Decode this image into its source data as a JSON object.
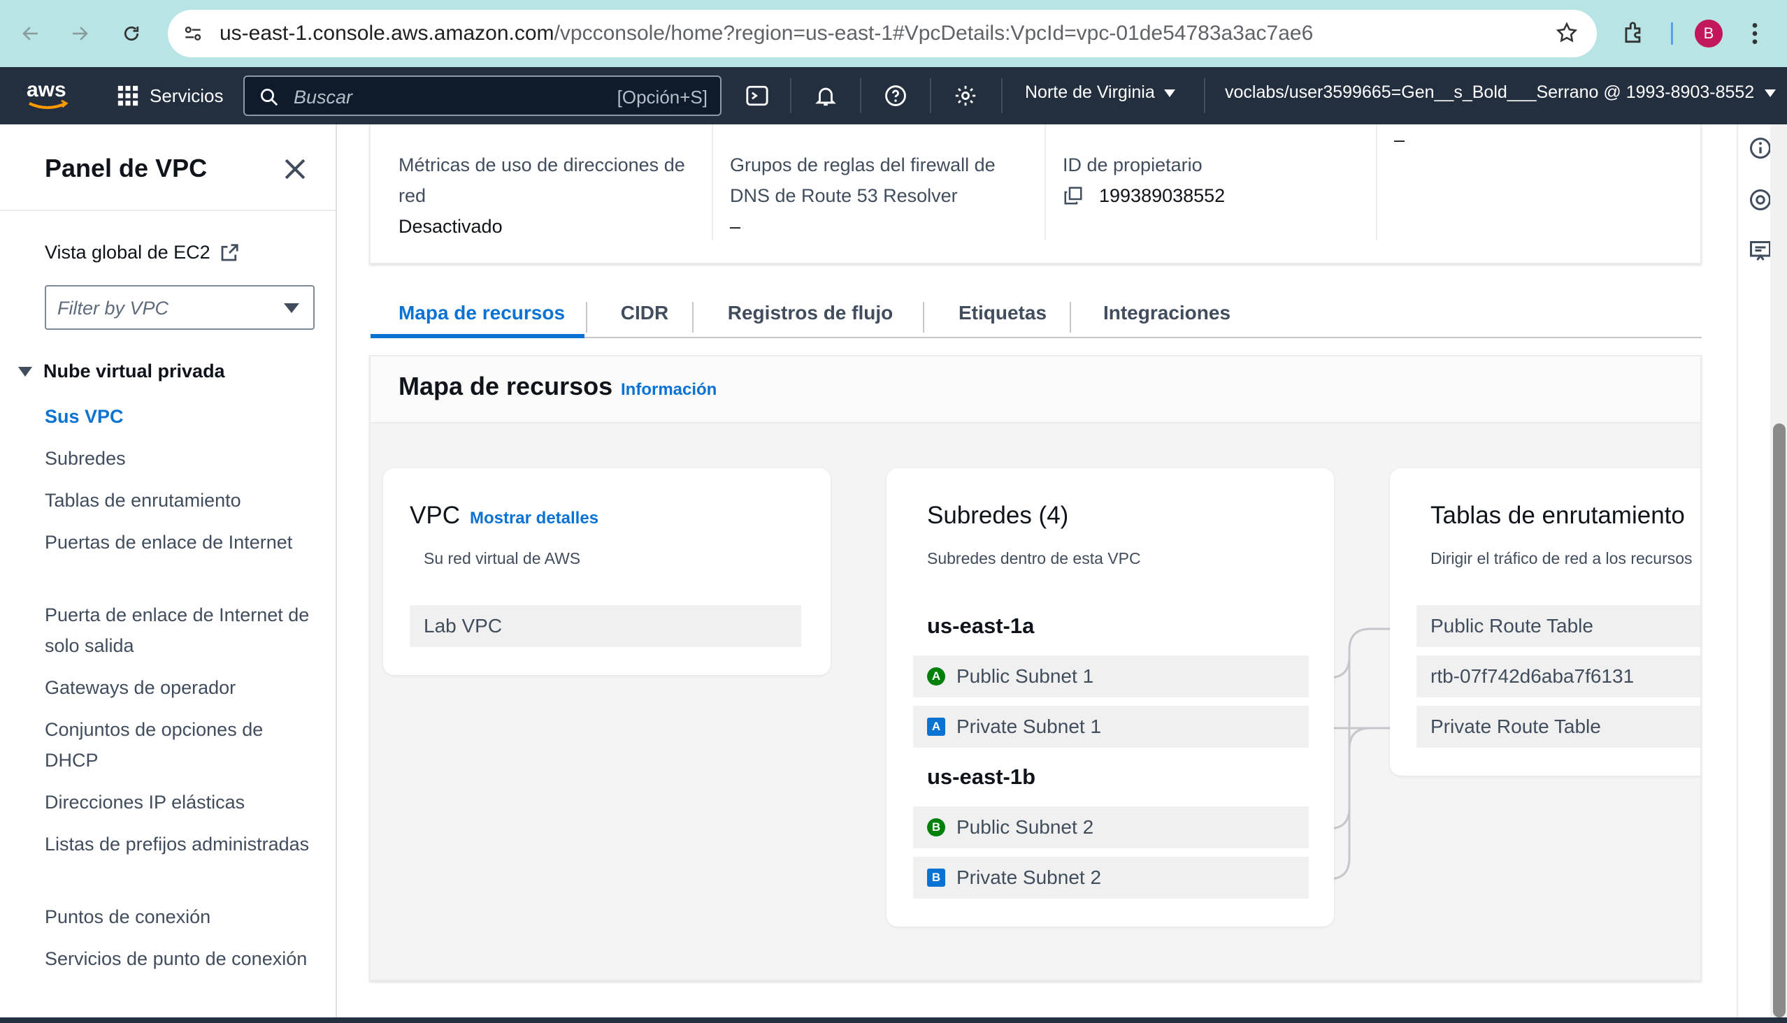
{
  "browser": {
    "url_host": "us-east-1.console.aws.amazon.com",
    "url_path": "/vpcconsole/home?region=us-east-1#VpcDetails:VpcId=vpc-01de54783a3ac7ae6",
    "profile_initial": "B"
  },
  "topnav": {
    "services_label": "Servicios",
    "search_placeholder": "Buscar",
    "search_shortcut": "[Opción+S]",
    "region": "Norte de Virginia",
    "account": "voclabs/user3599665=Gen__s_Bold___Serrano @ 1993-8903-8552"
  },
  "sidebar": {
    "title": "Panel de VPC",
    "ec2_global": "Vista global de EC2",
    "filter_placeholder": "Filter by VPC",
    "section": "Nube virtual privada",
    "items": [
      "Sus VPC",
      "Subredes",
      "Tablas de enrutamiento",
      "Puertas de enlace de Internet",
      "Puerta de enlace de Internet de solo salida",
      "Gateways de operador",
      "Conjuntos de opciones de DHCP",
      "Direcciones IP elásticas",
      "Listas de prefijos administradas",
      "Puntos de conexión",
      "Servicios de punto de conexión"
    ]
  },
  "details": {
    "col1_label": "Métricas de uso de direcciones de red",
    "col1_value": "Desactivado",
    "col2_label": "Grupos de reglas del firewall de DNS de Route 53 Resolver",
    "col2_value": "–",
    "col3_label": "ID de propietario",
    "col3_value": "199389038552",
    "col4_value": "–"
  },
  "tabs": [
    "Mapa de recursos",
    "CIDR",
    "Registros de flujo",
    "Etiquetas",
    "Integraciones"
  ],
  "resource_map": {
    "title": "Mapa de recursos",
    "info": "Información",
    "vpc": {
      "title": "VPC",
      "link": "Mostrar detalles",
      "subtitle": "Su red virtual de AWS",
      "name": "Lab VPC"
    },
    "subnets": {
      "title": "Subredes (4)",
      "subtitle": "Subredes dentro de esta VPC",
      "az1": "us-east-1a",
      "az2": "us-east-1b",
      "items": [
        {
          "badge": "A",
          "name": "Public Subnet 1"
        },
        {
          "badge": "A",
          "name": "Private Subnet 1"
        },
        {
          "badge": "B",
          "name": "Public Subnet 2"
        },
        {
          "badge": "B",
          "name": "Private Subnet 2"
        }
      ]
    },
    "route_tables": {
      "title": "Tablas de enrutamiento",
      "subtitle": "Dirigir el tráfico de red a los recursos",
      "items": [
        "Public Route Table",
        "rtb-07f742d6aba7f6131",
        "Private Route Table"
      ]
    }
  },
  "colors": {
    "accent": "#0972d3",
    "aws_nav": "#232f3e",
    "public_badge": "#037f0c",
    "private_badge": "#0972d3"
  }
}
